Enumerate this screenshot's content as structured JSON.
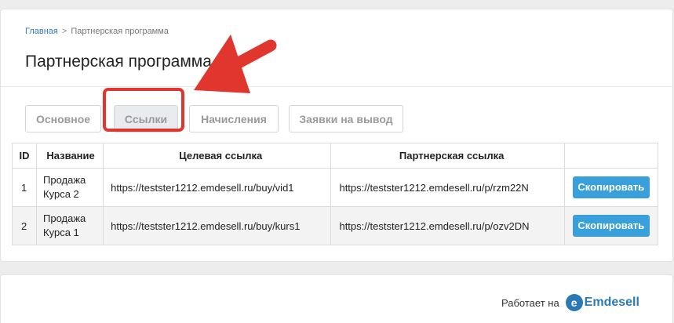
{
  "breadcrumb": {
    "home": "Главная",
    "separator": ">",
    "current": "Партнерская программа"
  },
  "main": {
    "title": "Партнерская программа"
  },
  "tabs": [
    {
      "label": "Основное",
      "active": false
    },
    {
      "label": "Ссылки",
      "active": true
    },
    {
      "label": "Начисления",
      "active": false
    },
    {
      "label": "Заявки на вывод",
      "active": false
    }
  ],
  "table": {
    "headers": {
      "id": "ID",
      "name": "Название",
      "target": "Целевая ссылка",
      "partner": "Партнерская ссылка",
      "action": ""
    },
    "rows": [
      {
        "id": "1",
        "name": "Продажа Курса 2",
        "target": "https://testster1212.emdesell.ru/buy/vid1",
        "partner": "https://testster1212.emdesell.ru/p/rzm22N",
        "action": "Скопировать"
      },
      {
        "id": "2",
        "name": "Продажа Курса 1",
        "target": "https://testster1212.emdesell.ru/buy/kurs1",
        "partner": "https://testster1212.emdesell.ru/p/ozv2DN",
        "action": "Скопировать"
      }
    ]
  },
  "footer": {
    "powered_by": "Работает на",
    "brand_logo": "e",
    "brand_name": "Emdesell"
  },
  "colors": {
    "accent": "#3aa0dc",
    "highlight": "#e0362d",
    "link": "#2f7bbf",
    "brand": "#2a79b5"
  }
}
